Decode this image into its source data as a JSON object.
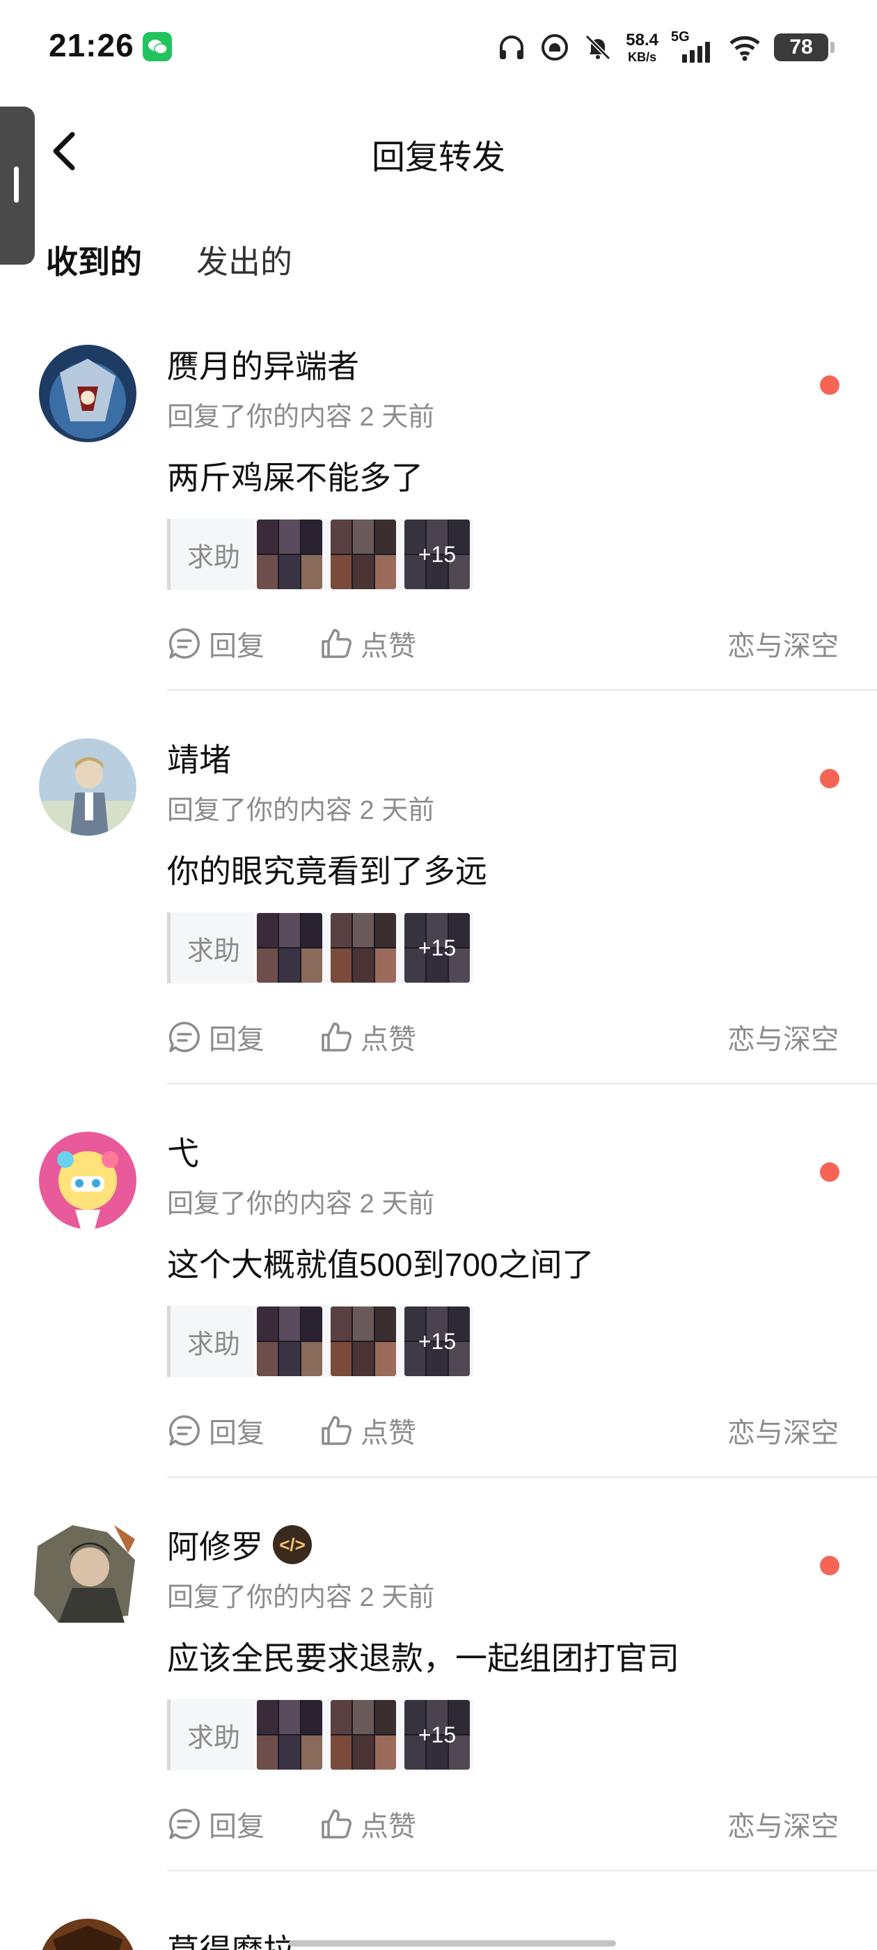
{
  "status_bar": {
    "time": "21:26",
    "net_speed_value": "58.4",
    "net_speed_unit": "KB/s",
    "network": "5G",
    "battery": "78"
  },
  "header": {
    "title": "回复转发"
  },
  "tabs": [
    {
      "label": "收到的",
      "active": true
    },
    {
      "label": "发出的",
      "active": false
    }
  ],
  "messages": [
    {
      "user": "赝月的异端者",
      "meta": "回复了你的内容 2 天前",
      "text": "两斤鸡屎不能多了",
      "quote_label": "求助",
      "more_count": "+15",
      "reply_label": "回复",
      "like_label": "点赞",
      "topic": "恋与深空",
      "unread": true
    },
    {
      "user": "靖堵",
      "meta": "回复了你的内容 2 天前",
      "text": "你的眼究竟看到了多远",
      "quote_label": "求助",
      "more_count": "+15",
      "reply_label": "回复",
      "like_label": "点赞",
      "topic": "恋与深空",
      "unread": true
    },
    {
      "user": "弋",
      "meta": "回复了你的内容 2 天前",
      "text": "这个大概就值500到700之间了",
      "quote_label": "求助",
      "more_count": "+15",
      "reply_label": "回复",
      "like_label": "点赞",
      "topic": "恋与深空",
      "unread": true
    },
    {
      "user": "阿修罗",
      "meta": "回复了你的内容 2 天前",
      "text": "应该全民要求退款，一起组团打官司",
      "quote_label": "求助",
      "more_count": "+15",
      "reply_label": "回复",
      "like_label": "点赞",
      "topic": "恋与深空",
      "unread": true
    },
    {
      "user": "莫得摩拉"
    }
  ],
  "colors": {
    "accent_underline": "#1fd0c0",
    "unread_dot": "#f56556",
    "secondary_text": "#8c8c8c",
    "wechat_green": "#22c35e"
  }
}
